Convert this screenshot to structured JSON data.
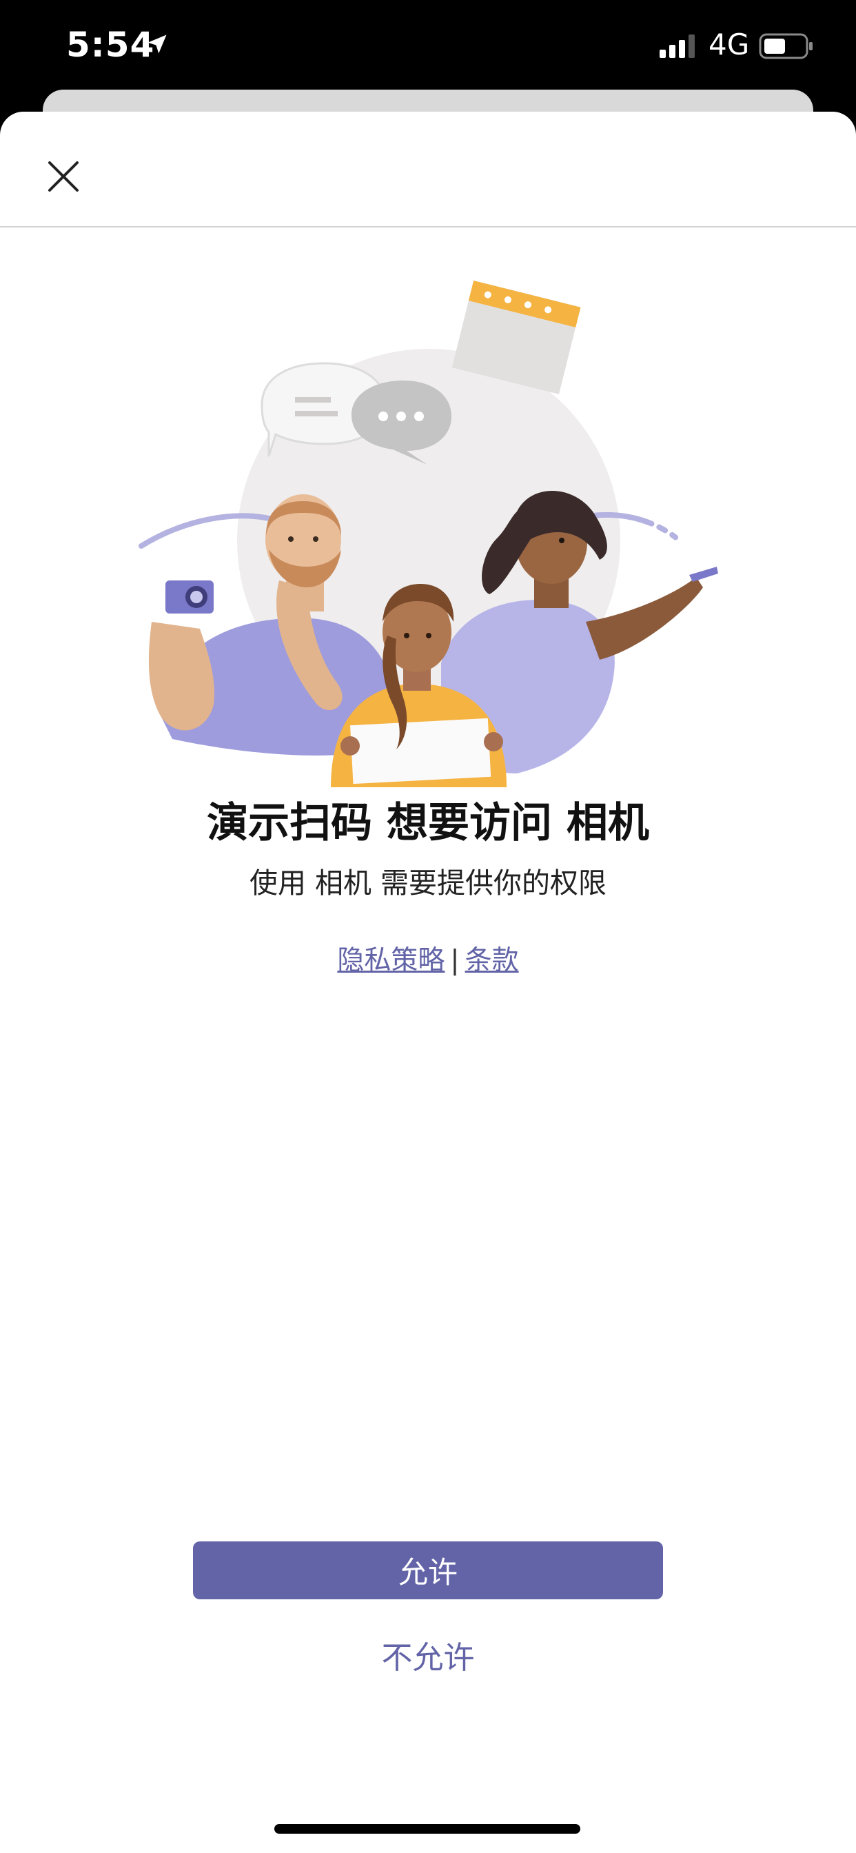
{
  "status_bar": {
    "time": "5:54",
    "network": "4G",
    "icons": [
      "location-arrow-icon",
      "signal-bars-icon",
      "battery-icon"
    ]
  },
  "dialog": {
    "close_icon": "close-icon",
    "title": "演示扫码 想要访问 相机",
    "subtitle": "使用 相机 需要提供你的权限",
    "privacy_link": "隐私策略",
    "separator": "|",
    "terms_link": "条款",
    "allow_label": "允许",
    "deny_label": "不允许"
  },
  "colors": {
    "accent": "#6264a7",
    "background": "#ffffff",
    "status_bar": "#000000"
  }
}
